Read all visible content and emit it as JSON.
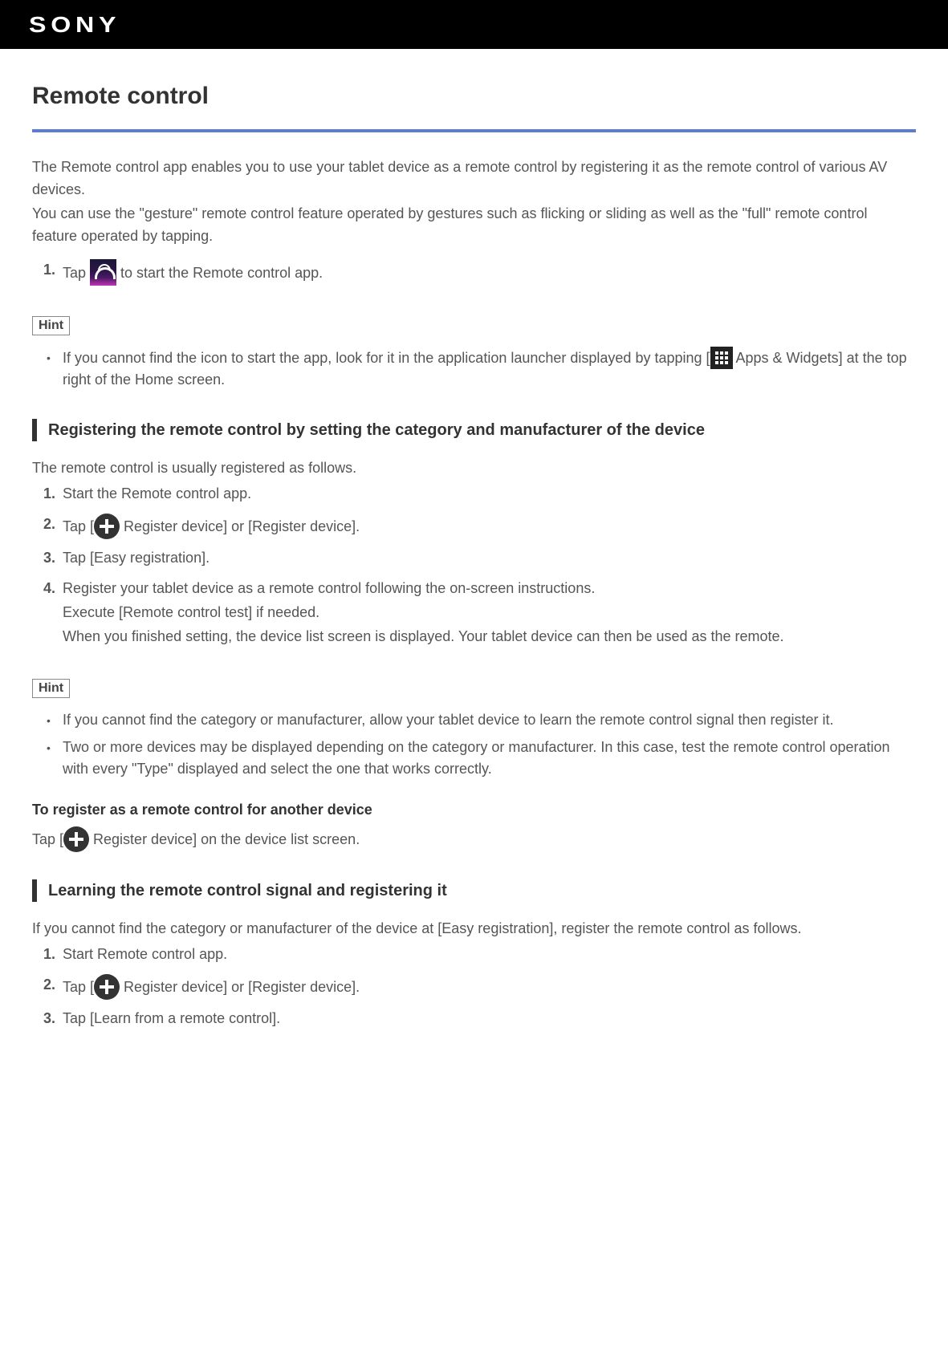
{
  "brand": "SONY",
  "title": "Remote control",
  "intro1": "The Remote control app enables you to use your tablet device as a remote control by registering it as the remote control of various AV devices.",
  "intro2": "You can use the \"gesture\" remote control feature operated by gestures such as flicking or sliding as well as the \"full\" remote control feature operated by tapping.",
  "step_intro": {
    "num": "1.",
    "pre": "Tap ",
    "post": " to start the Remote control app."
  },
  "hint_label": "Hint",
  "hint1": {
    "pre": "If you cannot find the icon to start the app, look for it in the application launcher displayed by tapping [",
    "post": " Apps & Widgets] at the top right of the Home screen."
  },
  "sec1_h": "Registering the remote control by setting the category and manufacturer of the device",
  "sec1_p": "The remote control is usually registered as follows.",
  "sec1_steps": {
    "s1": {
      "num": "1.",
      "text": "Start the Remote control app."
    },
    "s2": {
      "num": "2.",
      "pre": "Tap [",
      "post": " Register device] or [Register device]."
    },
    "s3": {
      "num": "3.",
      "text": "Tap [Easy registration]."
    },
    "s4": {
      "num": "4.",
      "a": "Register your tablet device as a remote control following the on-screen instructions.",
      "b": "Execute [Remote control test] if needed.",
      "c": "When you finished setting, the device list screen is displayed. Your tablet device can then be used as the remote."
    }
  },
  "hints2": {
    "a": "If you cannot find the category or manufacturer, allow your tablet device to learn the remote control signal then register it.",
    "b": "Two or more devices may be displayed depending on the category or manufacturer. In this case, test the remote control operation with every \"Type\" displayed and select the one that works correctly."
  },
  "subh1": "To register as a remote control for another device",
  "subp1": {
    "pre": "Tap [",
    "post": " Register device] on the device list screen."
  },
  "sec2_h": "Learning the remote control signal and registering it",
  "sec2_p": "If you cannot find the category or manufacturer of the device at [Easy registration], register the remote control as follows.",
  "sec2_steps": {
    "s1": {
      "num": "1.",
      "text": "Start Remote control app."
    },
    "s2": {
      "num": "2.",
      "pre": "Tap [",
      "post": " Register device] or [Register device]."
    },
    "s3": {
      "num": "3.",
      "text": "Tap [Learn from a remote control]."
    }
  }
}
